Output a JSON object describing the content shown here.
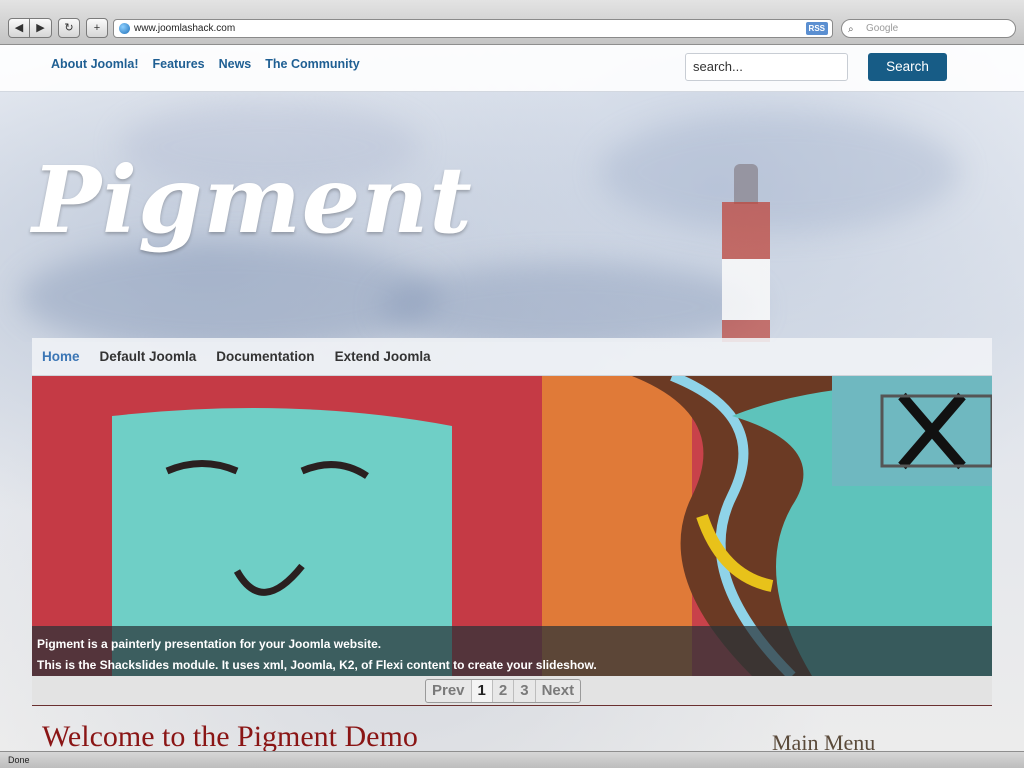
{
  "browser": {
    "url": "www.joomlashack.com",
    "rss_label": "RSS",
    "search_placeholder": "Google",
    "status": "Done"
  },
  "topnav": {
    "items": [
      "About Joomla!",
      "Features",
      "News",
      "The Community"
    ]
  },
  "site_search": {
    "value": "search...",
    "button_label": "Search"
  },
  "logo": "Pigment",
  "menu": {
    "items": [
      "Home",
      "Default Joomla",
      "Documentation",
      "Extend Joomla"
    ],
    "active": "Home"
  },
  "slideshow": {
    "caption_line1": "Pigment is a painterly presentation for your Joomla website.",
    "caption_line2": "This is the Shackslides module. It uses xml, Joomla, K2, of Flexi content to create your slideshow."
  },
  "pager": {
    "prev": "Prev",
    "pages": [
      "1",
      "2",
      "3"
    ],
    "current": "1",
    "next": "Next"
  },
  "content": {
    "welcome_title": "Welcome to the Pigment Demo",
    "sidebar_title": "Main Menu"
  },
  "colors": {
    "link_blue": "#1f5f93",
    "search_button": "#175c86",
    "title_red": "#8a1515"
  }
}
